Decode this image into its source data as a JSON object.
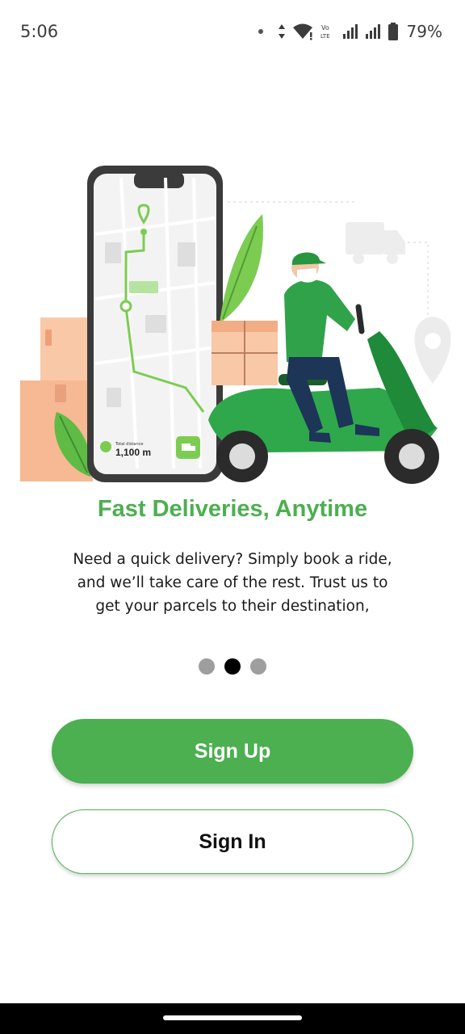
{
  "status_bar": {
    "time": "5:06",
    "battery": "79%",
    "icons": [
      "dot-icon",
      "data-arrows-icon",
      "wifi-icon",
      "volte-icon",
      "signal-icon",
      "signal-icon",
      "battery-icon"
    ]
  },
  "onboarding": {
    "title": "Fast Deliveries, Anytime",
    "description": "Need a quick delivery? Simply book a ride, and we’ll take care of the rest. Trust us to get your parcels to their destination,",
    "illustration": {
      "distance_label": "Total distance",
      "distance_value": "1,100 m"
    },
    "page_indicator": {
      "total": 3,
      "active_index": 1
    }
  },
  "actions": {
    "sign_up_label": "Sign Up",
    "sign_in_label": "Sign In"
  },
  "colors": {
    "accent": "#4caf50",
    "text_dark": "#1a1a1a",
    "dot_inactive": "#9e9e9e",
    "dot_active": "#000000"
  }
}
